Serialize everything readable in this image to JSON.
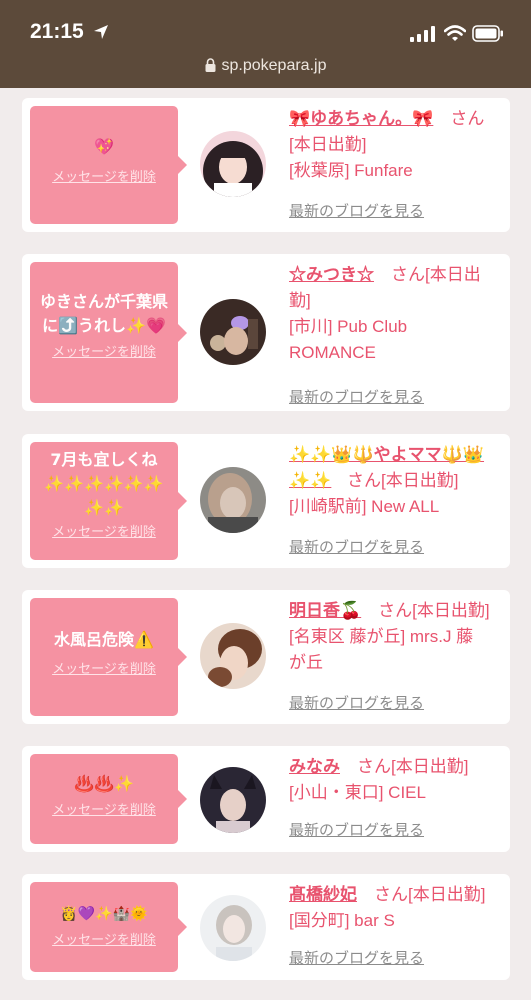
{
  "status_bar": {
    "time": "21:15",
    "url": "sp.pokepara.jp"
  },
  "delete_label": "メッセージを削除",
  "blog_label": "最新のブログを見る",
  "cards": [
    {
      "message": [
        "💖"
      ],
      "name": "🎀ゆあちゃん。🎀",
      "info_lines": [
        "さん",
        "[本日出勤]",
        "[秋葉原] Funfare"
      ]
    },
    {
      "message": [
        "ゆきさんが千葉県",
        "に⤴️うれし✨💗"
      ],
      "name": "☆みつき☆",
      "info_lines": [
        "さん[本日出",
        "勤]",
        "[市川] Pub Club",
        "ROMANCE"
      ]
    },
    {
      "message": [
        "7月も宜しくね",
        "✨✨✨✨✨✨",
        "✨✨"
      ],
      "name": "✨✨👑🔱やよママ🔱👑✨✨",
      "info_lines": [
        "さん[本日出勤]",
        "[川崎駅前] New ALL"
      ]
    },
    {
      "message": [
        "水風呂危険⚠️"
      ],
      "name": "明日香🍒",
      "info_lines": [
        "さん[本日出勤]",
        "[名東区 藤が丘] mrs.J 藤",
        "が丘"
      ]
    },
    {
      "message": [
        "♨️♨️✨"
      ],
      "name": "みなみ",
      "info_lines": [
        "さん[本日出勤]",
        "[小山・東口] CIEL"
      ]
    },
    {
      "message": [
        "👸💜✨🏰🌞"
      ],
      "name": "髙橋紗妃",
      "info_lines": [
        "さん[本日出勤]",
        "[国分町] bar S"
      ]
    }
  ]
}
